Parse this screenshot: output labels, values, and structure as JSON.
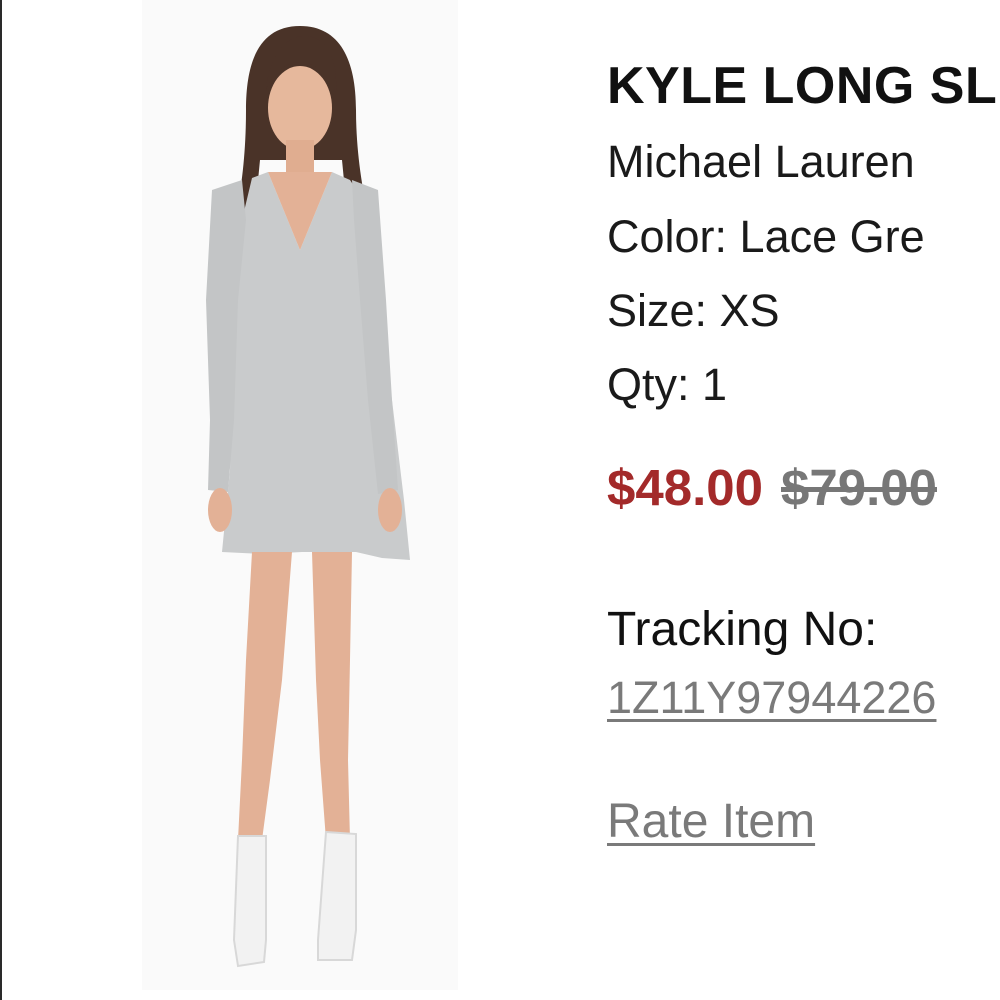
{
  "product": {
    "title": "KYLE LONG SL",
    "brand": "Michael Lauren",
    "color_line": "Color: Lace Gre",
    "size_line": "Size: XS",
    "qty_line": "Qty: 1",
    "sale_price": "$48.00",
    "original_price": "$79.00",
    "image_alt": "Model wearing grey long sleeve v-neck dress with white ankle boots"
  },
  "shipping": {
    "tracking_label": "Tracking No:",
    "tracking_number": "1Z11Y97944226"
  },
  "actions": {
    "rate_item_label": "Rate Item"
  },
  "colors": {
    "sale_price": "#a32a2a",
    "original_price": "#777777",
    "link": "#7a7a7a",
    "dress": "#c9cbcc",
    "boots": "#f2f2f2"
  }
}
